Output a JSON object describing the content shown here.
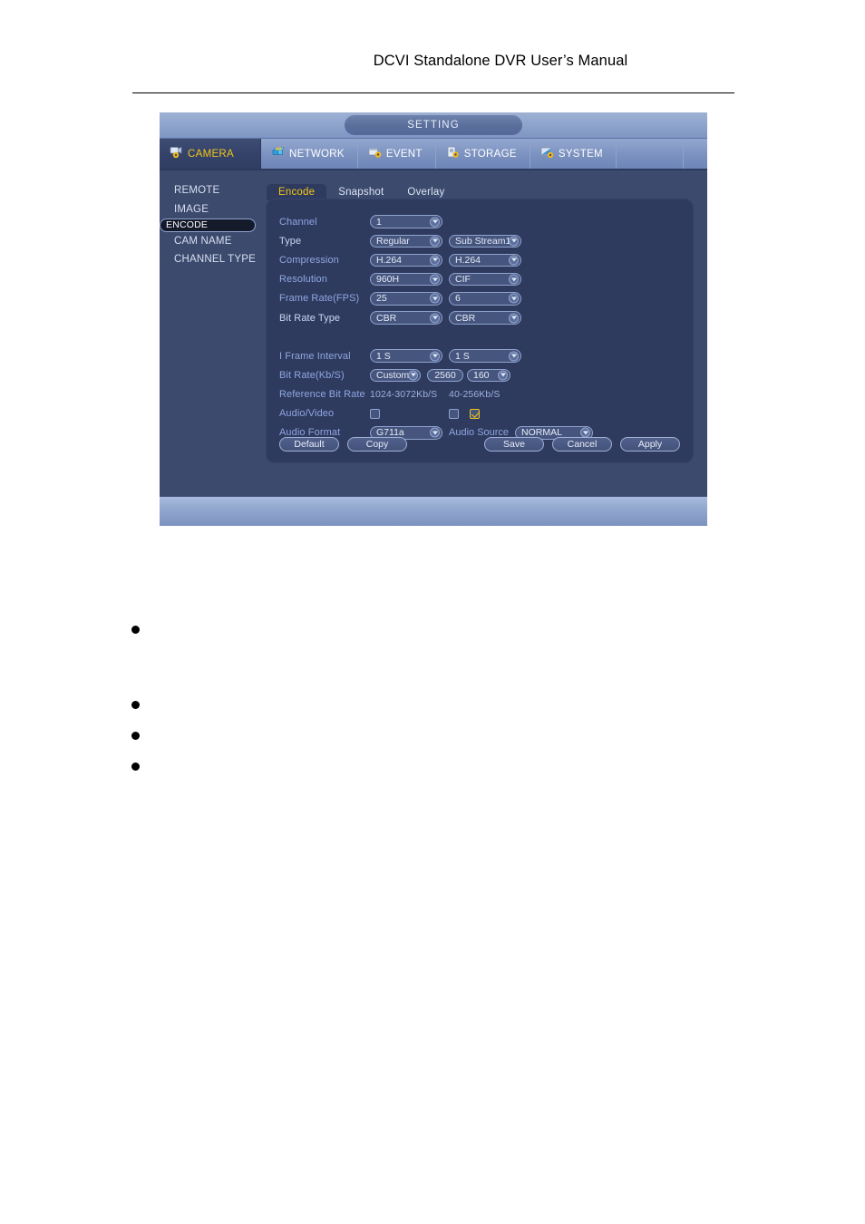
{
  "document": {
    "header_title": "DCVI Standalone DVR User’s Manual"
  },
  "window": {
    "title": "SETTING",
    "main_tabs": [
      {
        "label": "CAMERA",
        "icon": "camera-gear-icon",
        "active": true
      },
      {
        "label": "NETWORK",
        "icon": "network-icon",
        "active": false
      },
      {
        "label": "EVENT",
        "icon": "event-gear-icon",
        "active": false
      },
      {
        "label": "STORAGE",
        "icon": "storage-gear-icon",
        "active": false
      },
      {
        "label": "SYSTEM",
        "icon": "system-gear-icon",
        "active": false
      }
    ],
    "sidebar": {
      "items": [
        {
          "label": "REMOTE",
          "selected": false
        },
        {
          "label": "IMAGE",
          "selected": false
        },
        {
          "label": "ENCODE",
          "selected": true
        },
        {
          "label": "CAM NAME",
          "selected": false
        },
        {
          "label": "CHANNEL TYPE",
          "selected": false
        }
      ]
    },
    "content_tabs": [
      {
        "label": "Encode",
        "active": true
      },
      {
        "label": "Snapshot",
        "active": false
      },
      {
        "label": "Overlay",
        "active": false
      }
    ],
    "form": {
      "channel": {
        "label": "Channel",
        "main": "1"
      },
      "type": {
        "label": "Type",
        "main": "Regular",
        "sub": "Sub Stream1"
      },
      "compression": {
        "label": "Compression",
        "main": "H.264",
        "sub": "H.264"
      },
      "resolution": {
        "label": "Resolution",
        "main": "960H",
        "sub": "CIF"
      },
      "frame_rate": {
        "label": "Frame Rate(FPS)",
        "main": "25",
        "sub": "6"
      },
      "bit_rate_type": {
        "label": "Bit Rate Type",
        "main": "CBR",
        "sub": "CBR"
      },
      "i_frame_interval": {
        "label": "I Frame Interval",
        "main": "1 S",
        "sub": "1 S"
      },
      "bit_rate": {
        "label": "Bit Rate(Kb/S)",
        "mode": "Custom",
        "main": "2560",
        "sub": "160"
      },
      "reference_bit_rate": {
        "label": "Reference Bit Rate",
        "main": "1024-3072Kb/S",
        "sub": "40-256Kb/S"
      },
      "audio_video": {
        "label": "Audio/Video",
        "main_checked": false,
        "sub_checked": false,
        "extra_checked": true
      },
      "audio_format": {
        "label": "Audio Format",
        "main": "G711a"
      },
      "audio_source": {
        "label": "Audio Source",
        "value": "NORMAL"
      }
    },
    "buttons": {
      "default": "Default",
      "copy": "Copy",
      "save": "Save",
      "cancel": "Cancel",
      "apply": "Apply"
    }
  },
  "colors": {
    "accent_yellow": "#f5c518",
    "panel_bg": "#2f3b5e",
    "window_bg": "#3c4a6e",
    "label_blue": "#8fa6e2"
  }
}
